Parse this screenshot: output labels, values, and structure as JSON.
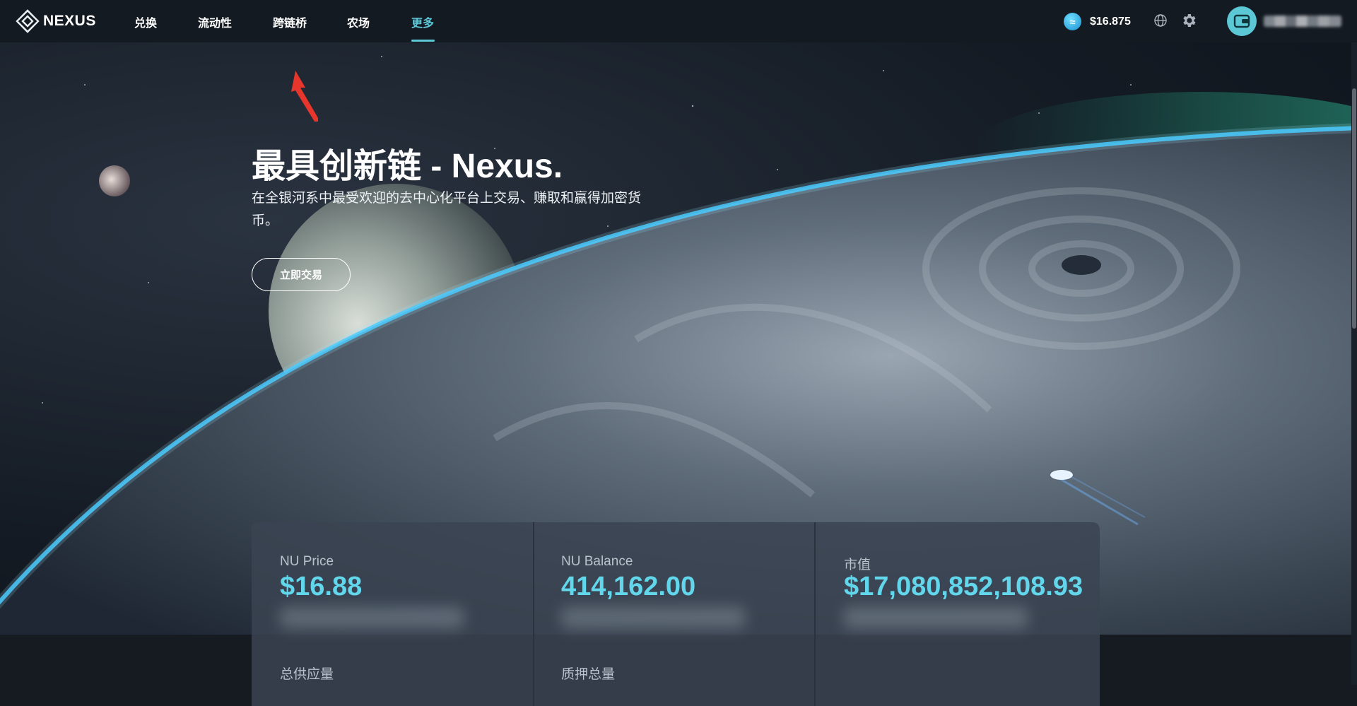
{
  "brand": {
    "name": "NEXUS"
  },
  "nav": {
    "items": [
      {
        "label": "兑换"
      },
      {
        "label": "流动性"
      },
      {
        "label": "跨链桥"
      },
      {
        "label": "农场"
      },
      {
        "label": "更多"
      }
    ],
    "active_index": 4
  },
  "header": {
    "token_price": "$16.875",
    "wallet_address_masked": ""
  },
  "hero": {
    "title": "最具创新链 - Nexus.",
    "subtitle": "在全银河系中最受欢迎的去中心化平台上交易、赚取和赢得加密货币。",
    "cta_label": "立即交易"
  },
  "stats": [
    {
      "label": "NU Price",
      "value": "$16.88"
    },
    {
      "label": "NU Balance",
      "value": "414,162.00"
    },
    {
      "label": "市值",
      "value": "$17,080,852,108.93"
    },
    {
      "label": "总供应量",
      "value": ""
    },
    {
      "label": "质押总量",
      "value": ""
    }
  ],
  "colors": {
    "accent": "#5cc8d6",
    "stat_value": "#62d7ec",
    "header_bg": "#141a21",
    "annotation_arrow": "#e8362c"
  },
  "icons": {
    "token": "token-coin-icon",
    "language": "globe-icon",
    "settings": "gear-icon",
    "wallet": "wallet-icon"
  }
}
